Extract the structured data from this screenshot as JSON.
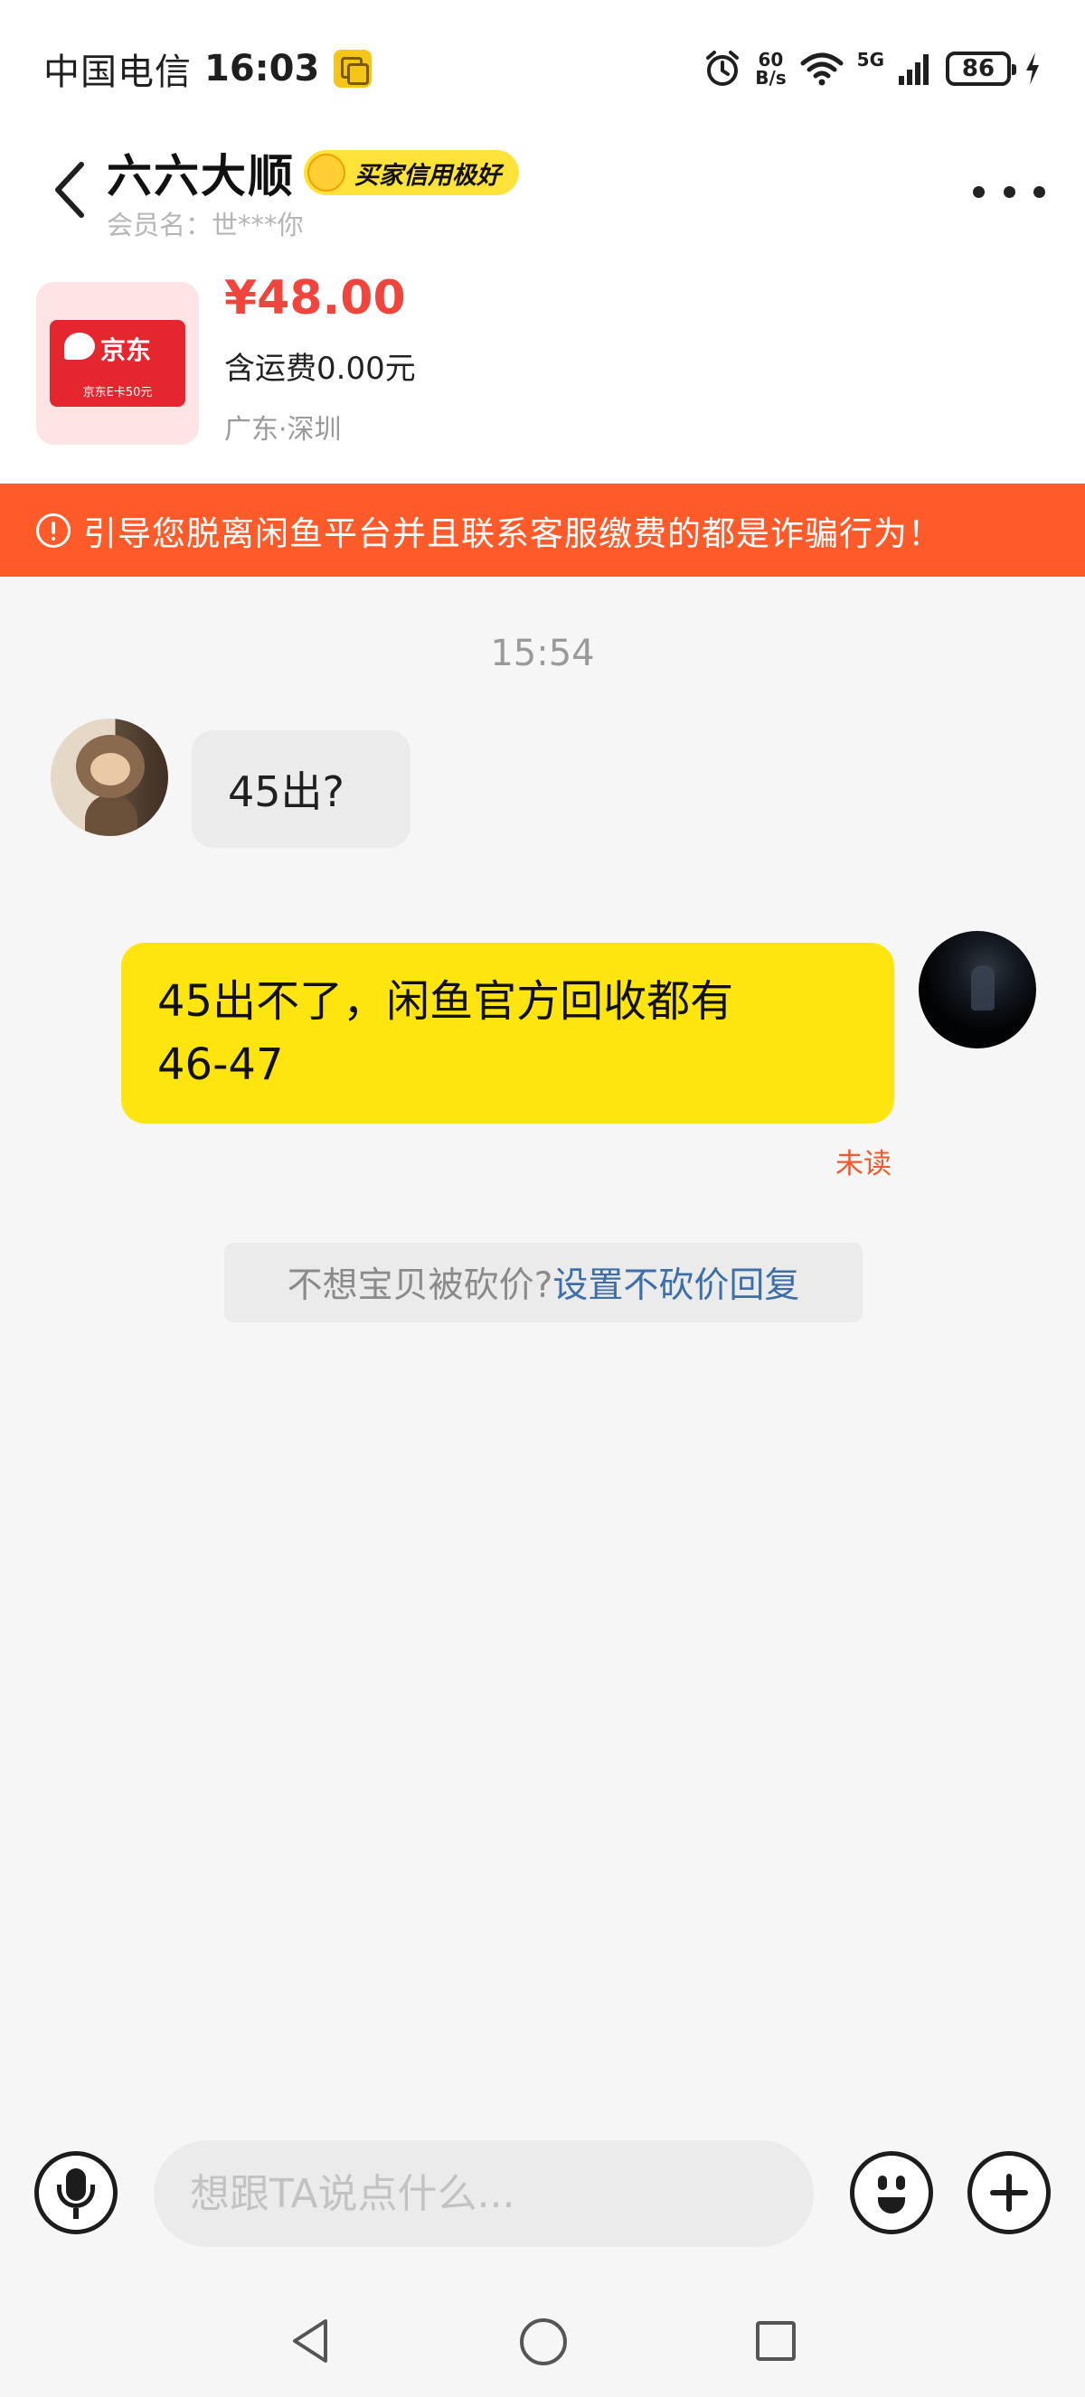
{
  "status_bar": {
    "carrier": "中国电信",
    "time": "16:03",
    "net_speed_value": "60",
    "net_speed_unit": "B/s",
    "network_type": "5G",
    "battery_level": "86",
    "icons": [
      "app-notification-icon",
      "alarm-icon",
      "wifi-icon",
      "signal-icon",
      "battery-icon",
      "charging-icon"
    ]
  },
  "header": {
    "seller_name": "六六大顺",
    "credit_badge": "买家信用极好",
    "member_name": "会员名：世***你",
    "icons": [
      "back-arrow-icon",
      "more-icon"
    ]
  },
  "product": {
    "price": "¥48.00",
    "shipping": "含运费0.00元",
    "location": "广东·深圳",
    "card_brand": "京东",
    "card_caption": "京东E卡50元"
  },
  "warning": {
    "text": "引导您脱离闲鱼平台并且联系客服缴费的都是诈骗行为！",
    "icon": "alert-circle-icon"
  },
  "chat": {
    "time_divider": "15:54",
    "messages": [
      {
        "side": "left",
        "line1": "45出?"
      },
      {
        "side": "right",
        "line1": "45出不了，闲鱼官方回收都有",
        "line2": "46-47",
        "status": "未读"
      }
    ]
  },
  "bargain_tip": {
    "prefix": "不想宝贝被砍价?",
    "link": "设置不砍价回复"
  },
  "input_bar": {
    "placeholder": "想跟TA说点什么...",
    "icons": [
      "microphone-icon",
      "emoji-icon",
      "plus-icon"
    ]
  },
  "nav_bar": {
    "icons": [
      "nav-back-icon",
      "nav-home-icon",
      "nav-recent-apps-icon"
    ]
  },
  "colors": {
    "accent_yellow": "#ffe50f",
    "price_red": "#f0453c",
    "warning_orange": "#ff5a2a",
    "link_blue": "#3c6fa8",
    "unread_orange": "#f0592e"
  }
}
